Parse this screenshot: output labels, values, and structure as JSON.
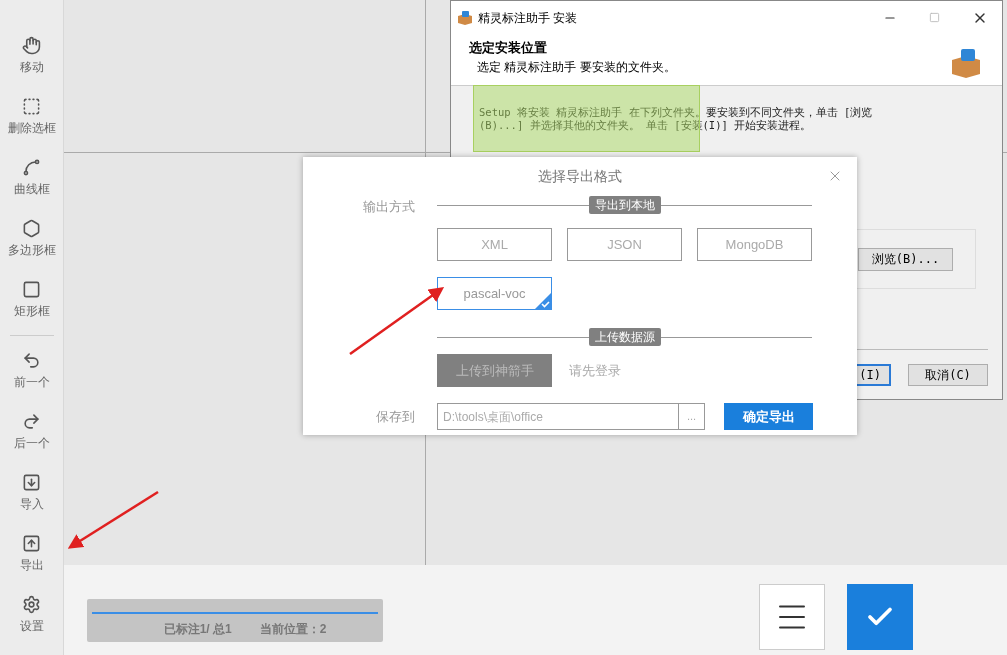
{
  "toolbar": {
    "items": [
      {
        "label": "移动"
      },
      {
        "label": "删除选框"
      },
      {
        "label": "曲线框"
      },
      {
        "label": "多边形框"
      },
      {
        "label": "矩形框"
      },
      {
        "label": "前一个"
      },
      {
        "label": "后一个"
      },
      {
        "label": "导入"
      },
      {
        "label": "导出"
      },
      {
        "label": "设置"
      }
    ]
  },
  "installer": {
    "title": "精灵标注助手 安装",
    "heading": "选定安装位置",
    "subheading": "选定 精灵标注助手 要安装的文件夹。",
    "description": [
      "Setup 将安装 精灵标注助手 在下列文件夹。要安装到不同文件夹，单击 [浏览",
      "(B)...] 并选择其他的文件夹。 单击 [安装(I)] 开始安装进程。"
    ],
    "browse_button": "浏览(B)...",
    "install_button": "(I)",
    "cancel_button": "取消(C)"
  },
  "dialog": {
    "title": "选择导出格式",
    "output_label": "输出方式",
    "local_section": "导出到本地",
    "formats": [
      {
        "label": "XML",
        "selected": false
      },
      {
        "label": "JSON",
        "selected": false
      },
      {
        "label": "MongoDB",
        "selected": false
      },
      {
        "label": "pascal-voc",
        "selected": true
      }
    ],
    "upload_section": "上传数据源",
    "upload_button": {
      "label": "上传到神箭手",
      "disabled": true
    },
    "login_hint": "请先登录",
    "save_label": "保存到",
    "save_path": "D:\\tools\\桌面\\office",
    "browse_button": "...",
    "confirm_button": "确定导出"
  },
  "status": {
    "level": 1,
    "annotated": "已标注1/ 总1",
    "position": "当前位置：2"
  }
}
